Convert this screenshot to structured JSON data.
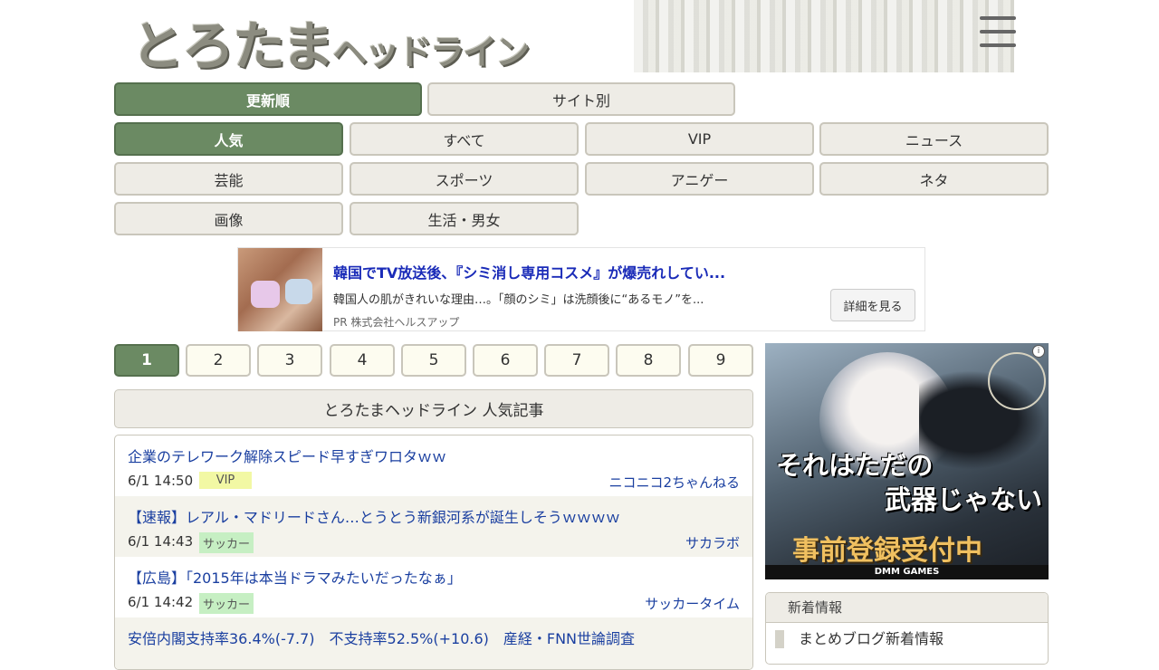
{
  "header": {
    "logo_main": "とろたま",
    "logo_sub": "ヘッドライン"
  },
  "sort_tabs": [
    {
      "label": "更新順",
      "active": true
    },
    {
      "label": "サイト別",
      "active": false
    }
  ],
  "categories": [
    {
      "label": "人気",
      "active": true
    },
    {
      "label": "すべて",
      "active": false
    },
    {
      "label": "VIP",
      "active": false
    },
    {
      "label": "ニュース",
      "active": false
    },
    {
      "label": "芸能",
      "active": false
    },
    {
      "label": "スポーツ",
      "active": false
    },
    {
      "label": "アニゲー",
      "active": false
    },
    {
      "label": "ネタ",
      "active": false
    },
    {
      "label": "画像",
      "active": false
    },
    {
      "label": "生活・男女",
      "active": false
    }
  ],
  "ad": {
    "title": "韓国でTV放送後、『シミ消し専用コスメ』が爆売れしてい...",
    "description": "韓国人の肌がきれいな理由…。「顔のシミ」は洗顔後に“あるモノ”を...",
    "sponsor": "PR 株式会社ヘルスアップ",
    "cta": "詳細を見る"
  },
  "pagination": {
    "pages": [
      "1",
      "2",
      "3",
      "4",
      "5",
      "6",
      "7",
      "8",
      "9"
    ],
    "current": "1"
  },
  "section_title": "とろたまヘッドライン 人気記事",
  "articles": [
    {
      "title": "企業のテレワーク解除スピード早すぎワロタｗｗ",
      "date": "6/1 14:50",
      "category": "VIP",
      "site": "ニコニコ2ちゃんねる"
    },
    {
      "title": "【速報】レアル・マドリードさん…とうとう新銀河系が誕生しそうｗｗｗｗ",
      "date": "6/1 14:43",
      "category": "サッカー",
      "site": "サカラボ"
    },
    {
      "title": "【広島】「2015年は本当ドラマみたいだったなぁ」",
      "date": "6/1 14:42",
      "category": "サッカー",
      "site": "サッカータイム"
    },
    {
      "title": "安倍内閣支持率36.4%(-7.7)　不支持率52.5%(+10.6)　産経・FNN世論調査",
      "date": "",
      "category": "",
      "site": ""
    }
  ],
  "side_ad": {
    "line1": "それはただの",
    "line2": "武器じゃない",
    "cta": "事前登録受付中",
    "brand": "DMM GAMES",
    "info": "i"
  },
  "new_info": {
    "heading": "新着情報",
    "items": [
      "まとめブログ新着情報"
    ]
  }
}
